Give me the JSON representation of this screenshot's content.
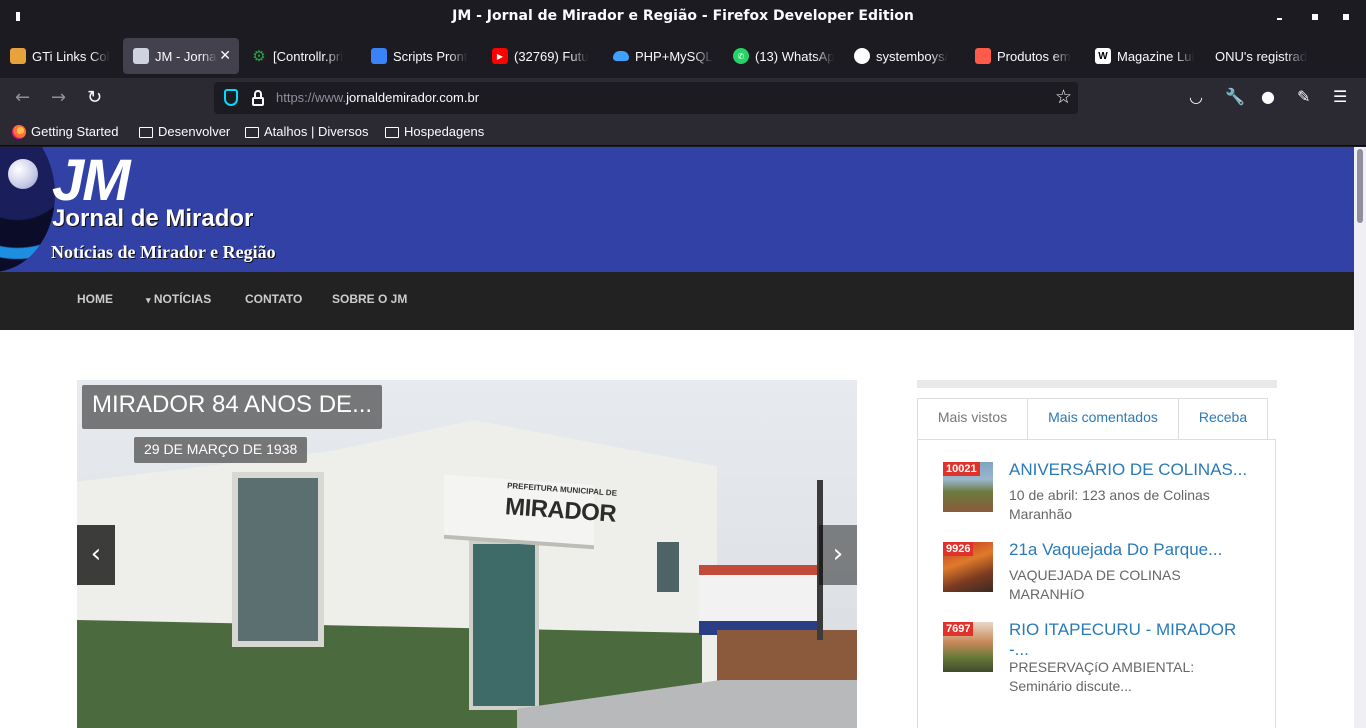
{
  "window": {
    "title": "JM - Jornal de Mirador e Região - Firefox Developer Edition"
  },
  "tabs": [
    {
      "label": "GTi Links Col",
      "icon": "gti-icon",
      "color": "#e8a23c"
    },
    {
      "label": "JM - Jornal",
      "icon": "jm-favicon-icon",
      "color": "#cfd3e0",
      "active": true
    },
    {
      "label": "[Controllr.pri",
      "icon": "gear-icon",
      "color": "#2ea043"
    },
    {
      "label": "Scripts Pront",
      "icon": "cube-icon",
      "color": "#3b82f6"
    },
    {
      "label": "(32769) Futu",
      "icon": "youtube-icon",
      "color": "#ff0000"
    },
    {
      "label": "PHP+MySQL",
      "icon": "cloud-icon",
      "color": "#3fa0ff"
    },
    {
      "label": "(13) WhatsAp",
      "icon": "whatsapp-icon",
      "color": "#25d366"
    },
    {
      "label": "systemboys/",
      "icon": "github-icon",
      "color": "#ffffff"
    },
    {
      "label": "Produtos em",
      "icon": "store-icon",
      "color": "#ff5a4a"
    },
    {
      "label": "Magazine Lui",
      "icon": "wikipedia-icon",
      "color": "#ffffff"
    },
    {
      "label": "ONU's registrad",
      "icon": "",
      "color": "#000000"
    }
  ],
  "navbar": {
    "url_scheme": "https://www.",
    "url_host": "jornaldemirador.com.br"
  },
  "bookmarks": [
    {
      "label": "Getting Started",
      "icon": "firefox-icon"
    },
    {
      "label": "Desenvolver",
      "icon": "folder-icon"
    },
    {
      "label": "Atalhos | Diversos",
      "icon": "folder-icon"
    },
    {
      "label": "Hospedagens",
      "icon": "folder-icon"
    }
  ],
  "site": {
    "logo_jm": "JM",
    "logo_name": "Jornal de Mirador",
    "logo_sub": "Notícias de Mirador e Região",
    "header_color": "#3141a6",
    "nav": [
      {
        "label": "HOME"
      },
      {
        "label": "NOTÍCIAS",
        "dropdown_marker": "▾"
      },
      {
        "label": "CONTATO"
      },
      {
        "label": "SOBRE O JM"
      }
    ],
    "slider": {
      "caption": "MIRADOR 84 ANOS DE...",
      "date": "29 DE MARÇO DE 1938",
      "sign_small": "PREFEITURA MUNICIPAL DE",
      "sign_big": "MIRADOR",
      "prev": "‹",
      "next": "›"
    },
    "sidebar": {
      "tabs": [
        "Mais vistos",
        "Mais comentados",
        "Receba"
      ],
      "posts": [
        {
          "views": "10021",
          "title": "ANIVERSÁRIO DE COLINAS...",
          "excerpt": "10 de abril: 123 anos de Colinas Maranhão"
        },
        {
          "views": "9926",
          "title": "21a Vaquejada Do Parque...",
          "excerpt": "VAQUEJADA DE COLINAS MARANHíO"
        },
        {
          "views": "7697",
          "title": "RIO ITAPECURU - MIRADOR -...",
          "excerpt": "PRESERVAÇíO AMBIENTAL: Seminário discute..."
        }
      ]
    }
  }
}
